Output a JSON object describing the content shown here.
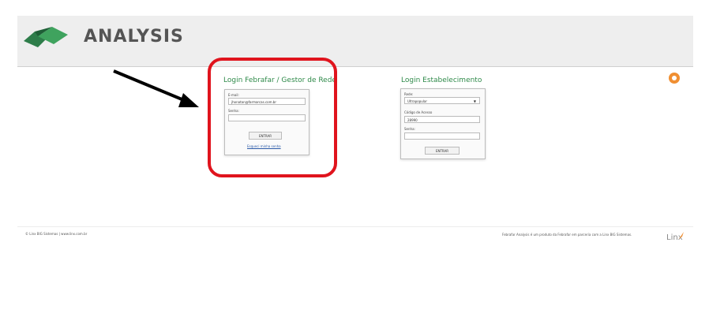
{
  "header": {
    "logo_text": "ANALYSIS"
  },
  "febrafar_login": {
    "title": "Login Febrafar / Gestor de Rede",
    "email_label": "E-mail:",
    "email_value": "jhonatan@farmarcas.com.br",
    "password_label": "Senha:",
    "password_value": "",
    "submit_label": "ENTRAR",
    "forgot_link": "Esqueci minha senha"
  },
  "establishment_login": {
    "title": "Login Estabelecimento",
    "network_label": "Rede:",
    "network_value": "Ultrapopular",
    "access_code_label": "Código de Acesso",
    "access_code_value": "28990",
    "password_label": "Senha:",
    "password_value": "",
    "submit_label": "ENTRAR"
  },
  "footer": {
    "left": "© Linx BIG Sistemas | www.linx.com.br",
    "right": "Febrafar Analysis é um produto da Febrafar em parceria com a Linx BIG Sistemas.",
    "brand": "Linx"
  },
  "colors": {
    "accent_green": "#2f8a4a",
    "highlight_red": "#e0141d",
    "orange_icon": "#f08f32"
  }
}
